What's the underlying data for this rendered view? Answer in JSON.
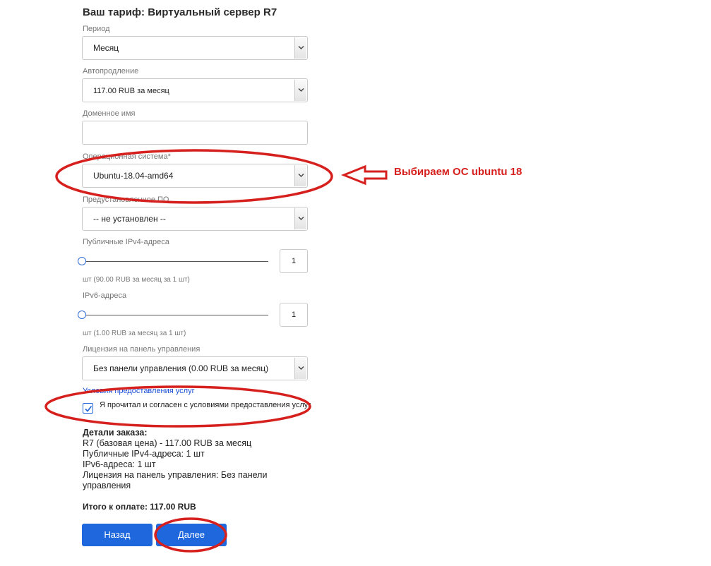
{
  "title": "Ваш тариф: Виртуальный сервер R7",
  "fields": {
    "period": {
      "label": "Период",
      "value": "Месяц"
    },
    "autorenew": {
      "label": "Автопродление",
      "value": "117.00 RUB за месяц"
    },
    "domain": {
      "label": "Доменное имя",
      "value": ""
    },
    "os": {
      "label": "Операционная система*",
      "value": "Ubuntu-18.04-amd64"
    },
    "software": {
      "label": "Предустановленное ПО",
      "value": "-- не установлен --"
    },
    "ipv4": {
      "label": "Публичные IPv4-адреса",
      "count": "1",
      "hint": "шт (90.00 RUB за месяц за 1 шт)",
      "level": 0
    },
    "ipv6": {
      "label": "IPv6-адреса",
      "count": "1",
      "hint": "шт (1.00 RUB за месяц за 1 шт)",
      "level": 0
    },
    "license": {
      "label": "Лицензия на панель управления",
      "value": "Без панели управления (0.00 RUB за месяц)"
    }
  },
  "terms": {
    "link": "Условия предоставления услуг",
    "agree": "Я прочитал и согласен с условиями предоставления услуг",
    "checked": true
  },
  "details": {
    "header": "Детали заказа:",
    "lines": [
      "R7 (базовая цена) - 117.00 RUB за месяц",
      "Публичные IPv4-адреса: 1 шт",
      "IPv6-адреса: 1 шт",
      "Лицензия на панель управления: Без панели управления"
    ]
  },
  "total": "Итого к оплате: 117.00 RUB",
  "buttons": {
    "back": "Назад",
    "next": "Далее"
  },
  "annotation": {
    "text": "Выбираем ОС ubuntu 18",
    "color": "#d6201e"
  },
  "colors": {
    "accent": "#1f67dc",
    "link": "#1a4fd8",
    "annotation": "#d6201e"
  }
}
